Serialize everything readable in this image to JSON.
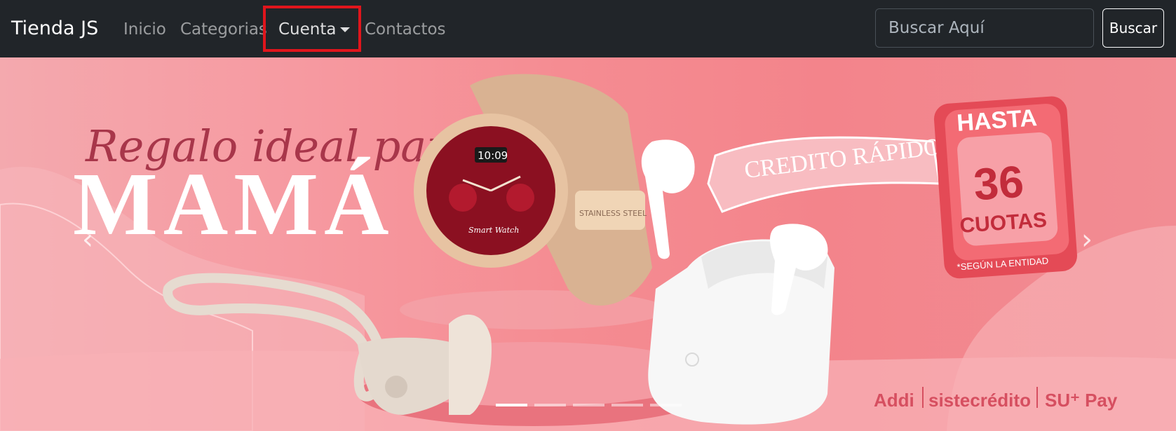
{
  "navbar": {
    "brand": "Tienda JS",
    "links": [
      "Inicio",
      "Categorias",
      "Cuenta",
      "Contactos"
    ],
    "search_placeholder": "Buscar Aquí",
    "search_button": "Buscar",
    "highlight_color": "#e0151c"
  },
  "banner": {
    "script_text": "Regalo ideal para",
    "headline": "MAMÁ",
    "ribbon": "CREDITO RÁPIDO",
    "badge_top": "HASTA",
    "badge_number": "36",
    "badge_unit": "CUOTAS",
    "badge_note": "*SEGÚN LA ENTIDAD",
    "watch_time": "10:09",
    "watch_brand": "Smart Watch",
    "strap_text": "STAINLESS STEEL",
    "partners": [
      "Addi",
      "sistecrédito",
      "SU⁺ Pay"
    ],
    "prev_icon": "chevron-left-icon",
    "next_icon": "chevron-right-icon",
    "slides_count": 5,
    "active_slide": 0
  }
}
